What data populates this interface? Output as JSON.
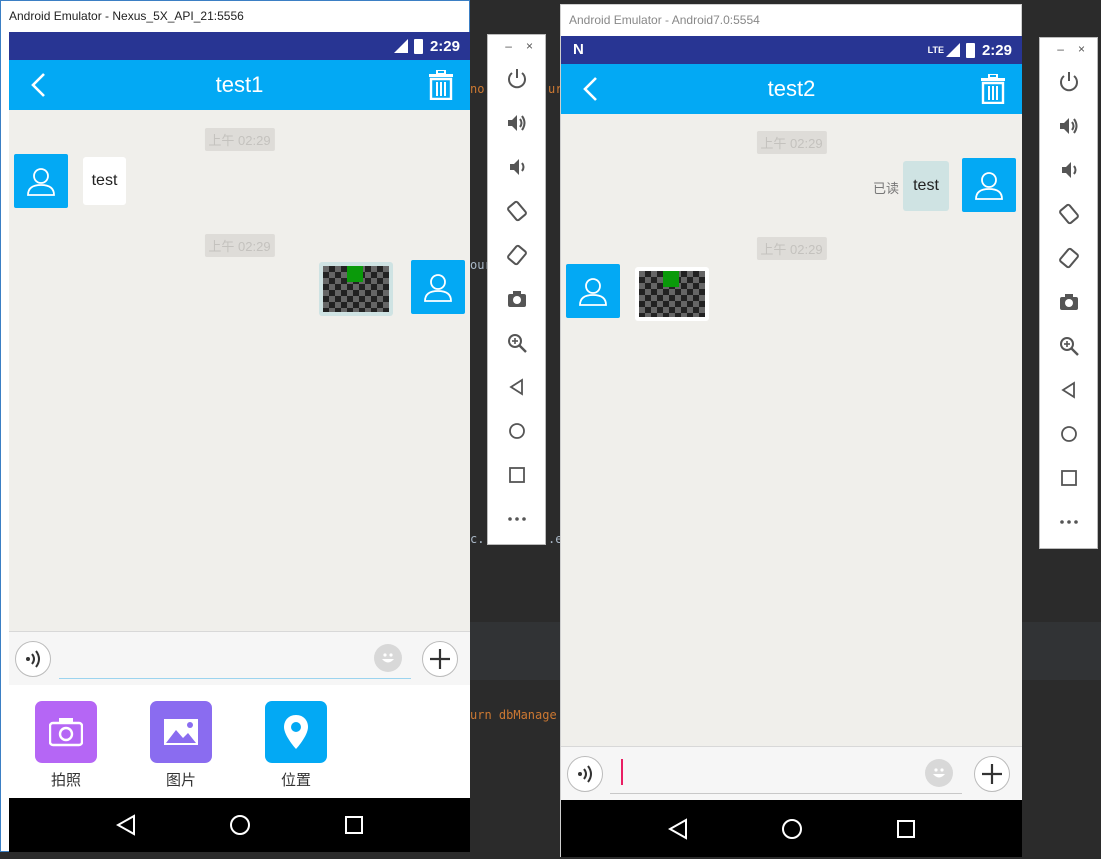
{
  "ide": {
    "code_snippets": [
      "no",
      "ur",
      "our",
      "c.",
      ".e",
      "urn dbManage"
    ]
  },
  "emulator1": {
    "window_title": "Android Emulator - Nexus_5X_API_21:5556",
    "status_time": "2:29",
    "chat_title": "test1",
    "messages": [
      {
        "timestamp": "上午 02:29",
        "text": "test"
      },
      {
        "timestamp": "上午 02:29"
      }
    ],
    "panel_items": [
      {
        "label": "拍照",
        "icon": "camera-icon",
        "color": "#b566f5"
      },
      {
        "label": "图片",
        "icon": "image-icon",
        "color": "#8a6cf0"
      },
      {
        "label": "位置",
        "icon": "location-icon",
        "color": "#03a9f4"
      }
    ]
  },
  "emulator2": {
    "window_title": "Android Emulator - Android7.0:5554",
    "status_time": "2:29",
    "status_network": "LTE",
    "chat_title": "test2",
    "messages": [
      {
        "timestamp": "上午 02:29",
        "text": "test",
        "read_status": "已读"
      },
      {
        "timestamp": "上午 02:29"
      }
    ]
  },
  "sidebar": {
    "minimize": "–",
    "close": "×",
    "tools": [
      "power-icon",
      "volume-up-icon",
      "volume-down-icon",
      "rotate-left-icon",
      "rotate-right-icon",
      "screenshot-icon",
      "zoom-icon",
      "back-icon",
      "home-icon",
      "overview-icon",
      "more-icon"
    ]
  },
  "colors": {
    "app_bar": "#03a9f4",
    "status_bar_1": "#283593",
    "status_bar_2": "#283593",
    "chat_bg": "#f0efeb"
  }
}
